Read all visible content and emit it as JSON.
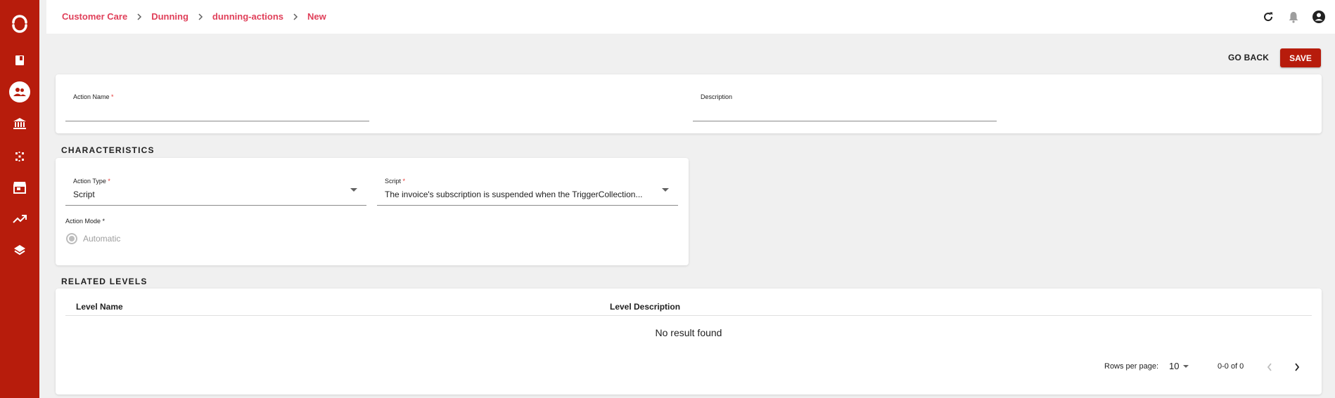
{
  "breadcrumb": [
    "Customer Care",
    "Dunning",
    "dunning-actions",
    "New"
  ],
  "header": {
    "icons": [
      "refresh-icon",
      "bell-icon",
      "account-circle-icon"
    ]
  },
  "sidebar": {
    "icons": [
      "logo-icon",
      "book-icon",
      "people-icon",
      "bank-icon",
      "grid-dots-icon",
      "store-icon",
      "trending-up-icon",
      "layers-icon"
    ],
    "active": "people-icon"
  },
  "actions": {
    "go_back": "GO BACK",
    "save": "SAVE"
  },
  "form": {
    "action_name": {
      "label": "Action Name",
      "required": "*",
      "value": ""
    },
    "description": {
      "label": "Description",
      "value": ""
    }
  },
  "characteristics": {
    "title": "CHARACTERISTICS",
    "action_type": {
      "label": "Action Type",
      "required": "*",
      "value": "Script"
    },
    "script": {
      "label": "Script",
      "required": "*",
      "value": "The invoice's subscription is suspended when the TriggerCollection..."
    },
    "action_mode": {
      "label": "Action Mode *",
      "option": "Automatic"
    }
  },
  "related_levels": {
    "title": "RELATED LEVELS",
    "columns": [
      "Level Name",
      "Level Description"
    ],
    "empty": "No result found",
    "rows_per_page_label": "Rows per page:",
    "rows_per_page": "10",
    "range": "0-0 of 0"
  },
  "colors": {
    "brand": "#b71c0c",
    "breadcrumb": "#e0405a"
  }
}
